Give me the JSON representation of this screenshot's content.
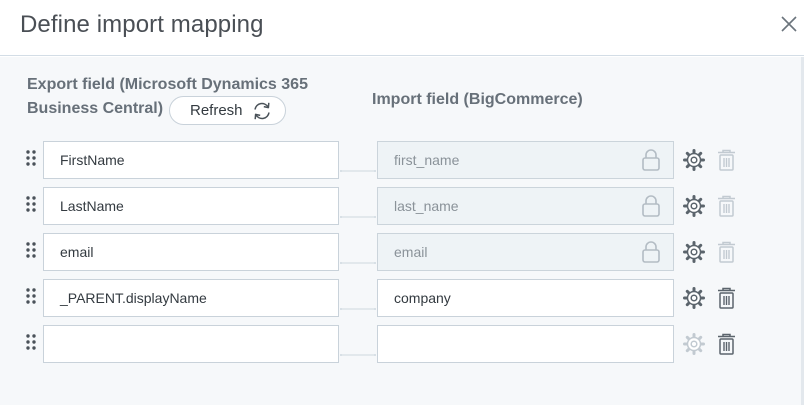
{
  "dialog": {
    "title": "Define import mapping"
  },
  "columns": {
    "export_header": "Export field (Microsoft Dynamics 365 Business Central)",
    "import_header": "Import field (BigCommerce)"
  },
  "refresh": {
    "label": "Refresh"
  },
  "rows": [
    {
      "export": "FirstName",
      "import": "first_name",
      "locked": true
    },
    {
      "export": "LastName",
      "import": "last_name",
      "locked": true
    },
    {
      "export": "email",
      "import": "email",
      "locked": true
    },
    {
      "export": "_PARENT.displayName",
      "import": "company",
      "locked": false
    },
    {
      "export": "",
      "import": "",
      "locked": false
    }
  ],
  "colors": {
    "icon_active": "#5b646c",
    "icon_disabled": "#c2cad1",
    "connector": "#cfd8df"
  }
}
